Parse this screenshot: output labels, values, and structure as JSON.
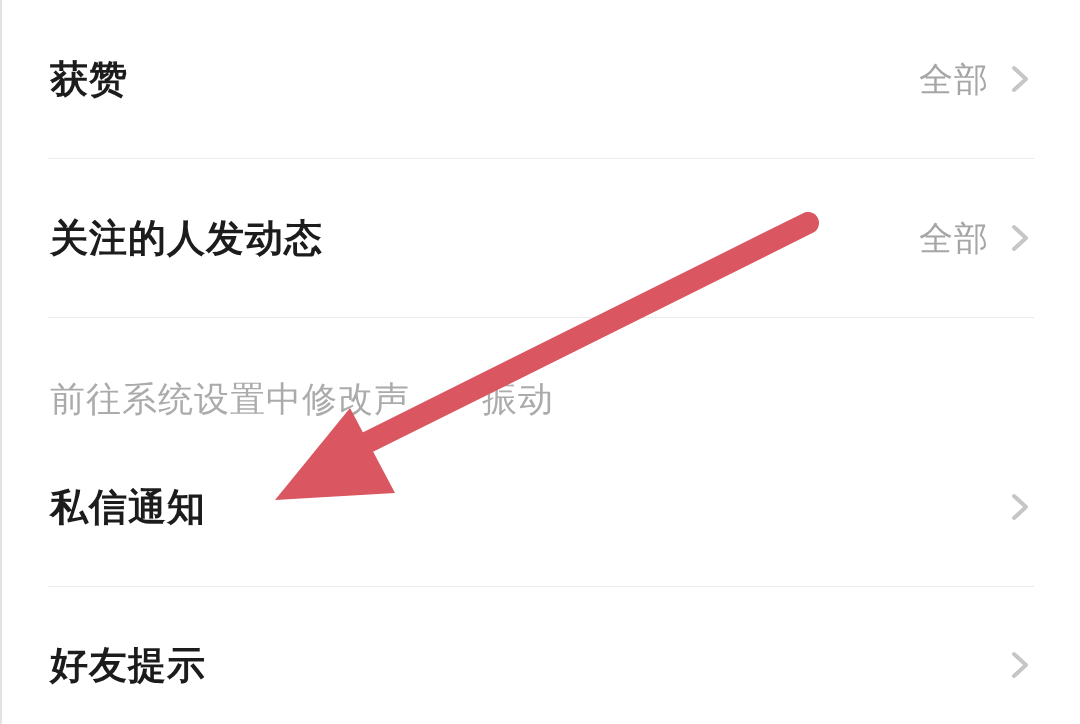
{
  "rows": [
    {
      "kind": "item",
      "label": "获赞",
      "value": "全部"
    },
    {
      "kind": "item",
      "label": "关注的人发动态",
      "value": "全部"
    },
    {
      "kind": "hint",
      "parts": [
        "前往系统设置中修改声",
        "振动"
      ]
    },
    {
      "kind": "item",
      "label": "私信通知"
    },
    {
      "kind": "item",
      "label": "好友提示"
    }
  ],
  "annotations": [
    {
      "kind": "arrow"
    }
  ]
}
